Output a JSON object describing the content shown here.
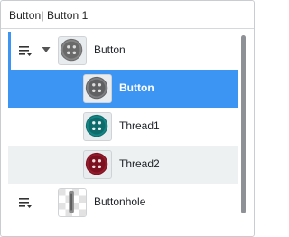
{
  "panel": {
    "title": "Button| Button 1"
  },
  "tree": {
    "items": [
      {
        "label": "Button",
        "depth": 0,
        "selected": false,
        "hasMenu": true,
        "expanded": true,
        "swatch": "#6a6a6a"
      },
      {
        "label": "Button",
        "depth": 1,
        "selected": true,
        "hasMenu": false,
        "swatch": "#5f6163"
      },
      {
        "label": "Thread1",
        "depth": 1,
        "selected": false,
        "hasMenu": false,
        "swatch": "#0e6b6b"
      },
      {
        "label": "Thread2",
        "depth": 1,
        "selected": false,
        "hasMenu": false,
        "alt": true,
        "swatch": "#7a1020"
      },
      {
        "label": "Buttonhole",
        "depth": 0,
        "selected": false,
        "hasMenu": true,
        "swatch": "checker"
      }
    ]
  },
  "colors": {
    "accent": "#3d95f3",
    "rowAlt": "#eef1f2",
    "scrollbar": "#8e9195"
  }
}
